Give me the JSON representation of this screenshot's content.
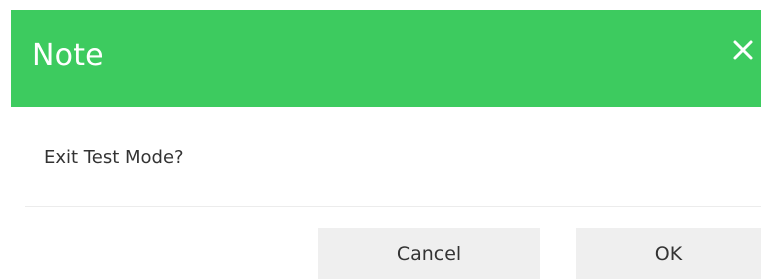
{
  "dialog": {
    "title": "Note",
    "close_icon": "close-icon",
    "message": "Exit Test Mode?",
    "buttons": {
      "cancel_label": "Cancel",
      "ok_label": "OK"
    }
  },
  "colors": {
    "header": "#3dcb5f",
    "button_bg": "#efefef",
    "text": "#333333"
  }
}
